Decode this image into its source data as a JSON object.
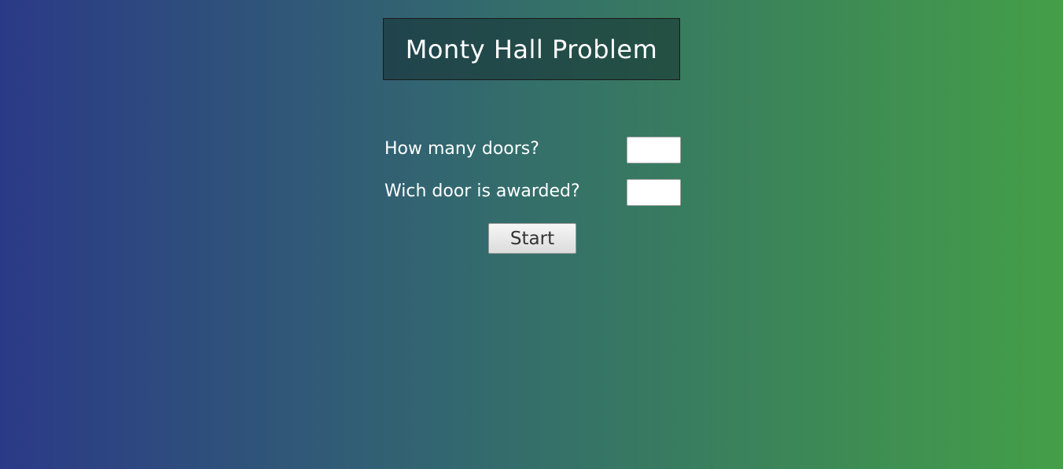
{
  "header": {
    "title": "Monty Hall Problem"
  },
  "form": {
    "doors": {
      "label": "How many doors?",
      "value": ""
    },
    "awarded": {
      "label": "Wich door is awarded?",
      "value": ""
    },
    "start_label": "Start"
  },
  "colors": {
    "background_left": "#2b3a87",
    "background_right": "#449f48",
    "title_box": "#244a4c",
    "text": "#ffffff"
  }
}
